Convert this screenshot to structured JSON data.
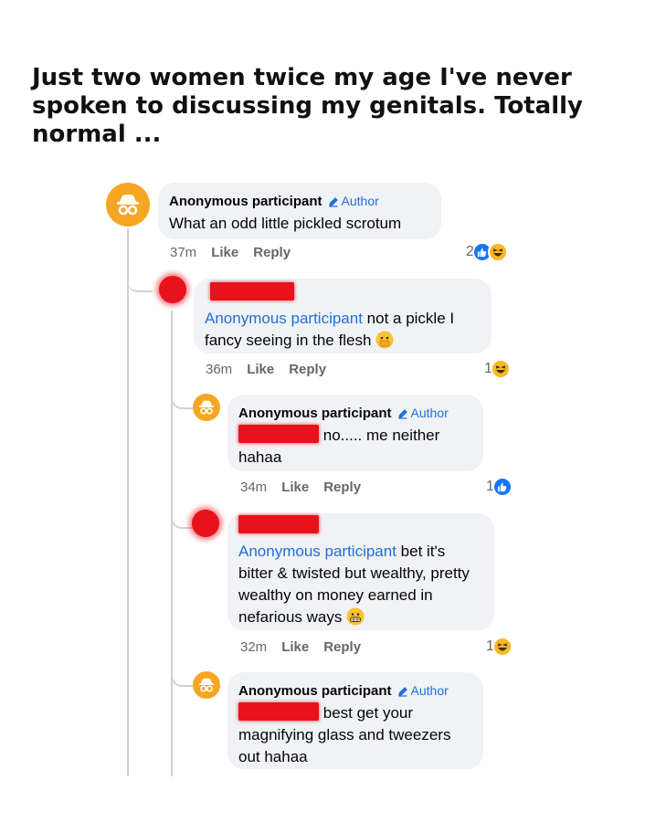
{
  "caption": "Just two women twice my age I've never spoken to discussing my genitals. Totally normal ...",
  "author_badge": "Author",
  "actions": {
    "like": "Like",
    "reply": "Reply"
  },
  "comments": [
    {
      "name": "Anonymous participant",
      "text": "What an odd little pickled scrotum",
      "time": "37m",
      "reactions": "2",
      "reaction_icons": [
        "like",
        "haha"
      ]
    },
    {
      "mention": "Anonymous participant",
      "text": "not a pickle I fancy seeing in the flesh",
      "time": "36m",
      "reactions": "1",
      "reaction_icons": [
        "haha"
      ]
    },
    {
      "name": "Anonymous participant",
      "text_line1": "no..... me neither",
      "text_line2": "hahaa",
      "time": "34m",
      "reactions": "1",
      "reaction_icons": [
        "like"
      ]
    },
    {
      "mention": "Anonymous participant",
      "text": "bet it's bitter & twisted but wealthy, pretty wealthy on money earned in nefarious ways",
      "time": "32m",
      "reactions": "1",
      "reaction_icons": [
        "haha"
      ]
    },
    {
      "name": "Anonymous participant",
      "text_line1": "best get your",
      "text_line2": "magnifying glass and tweezers out hahaa"
    }
  ],
  "colors": {
    "link": "#216fdb",
    "bubble": "#f0f2f5",
    "anon_avatar": "#f5a623",
    "redaction": "#e8121c"
  }
}
